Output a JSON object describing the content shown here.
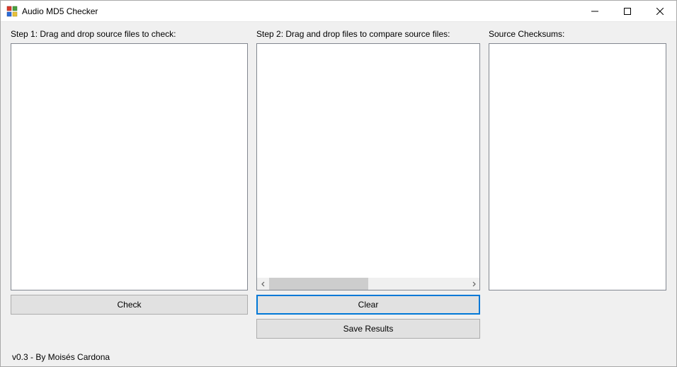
{
  "window": {
    "title": "Audio MD5 Checker"
  },
  "step1": {
    "label": "Step 1: Drag and drop source files to check:"
  },
  "step2": {
    "label": "Step 2: Drag and drop files to compare source files:"
  },
  "checksums": {
    "label": "Source Checksums:"
  },
  "buttons": {
    "check": "Check",
    "clear": "Clear",
    "saveResults": "Save Results"
  },
  "footer": {
    "text": "v0.3 - By Moisés Cardona"
  }
}
